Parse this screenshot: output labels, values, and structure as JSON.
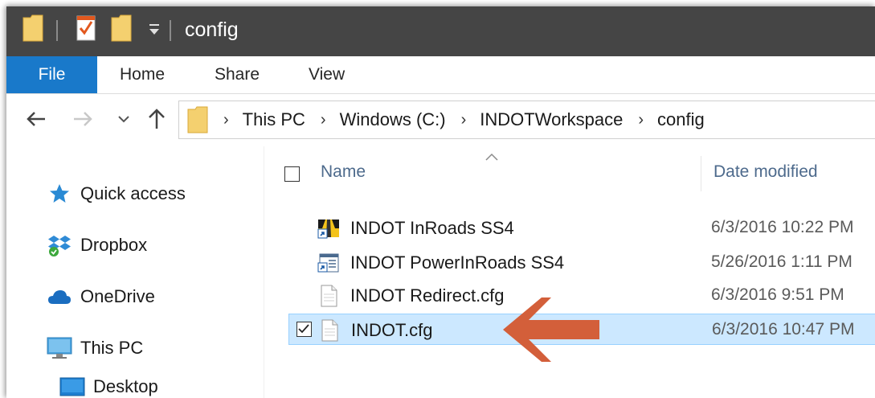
{
  "window": {
    "title": "config"
  },
  "ribbon": {
    "tabs": [
      "File",
      "Home",
      "Share",
      "View"
    ]
  },
  "address": {
    "crumbs": [
      "This PC",
      "Windows (C:)",
      "INDOTWorkspace",
      "config"
    ]
  },
  "nav_pane": {
    "items": [
      {
        "label": "Quick access",
        "icon": "star-pin-icon"
      },
      {
        "label": "Dropbox",
        "icon": "dropbox-icon"
      },
      {
        "label": "OneDrive",
        "icon": "cloud-icon"
      },
      {
        "label": "This PC",
        "icon": "computer-icon"
      },
      {
        "label": "Desktop",
        "icon": "desktop-icon"
      }
    ]
  },
  "file_list": {
    "columns": {
      "name": "Name",
      "date": "Date modified"
    },
    "files": [
      {
        "name": "INDOT InRoads SS4",
        "date": "6/3/2016 10:22 PM",
        "icon": "shortcut-inroads-icon",
        "selected": false
      },
      {
        "name": "INDOT PowerInRoads SS4",
        "date": "5/26/2016 1:11 PM",
        "icon": "shortcut-powerinroads-icon",
        "selected": false
      },
      {
        "name": "INDOT Redirect.cfg",
        "date": "6/3/2016 9:51 PM",
        "icon": "file-icon",
        "selected": false
      },
      {
        "name": "INDOT.cfg",
        "date": "6/3/2016 10:47 PM",
        "icon": "file-icon",
        "selected": true
      }
    ]
  },
  "colors": {
    "titlebar": "#454545",
    "file_tab": "#1979ca",
    "selection": "#cce8ff",
    "arrow": "#d35f3a"
  }
}
